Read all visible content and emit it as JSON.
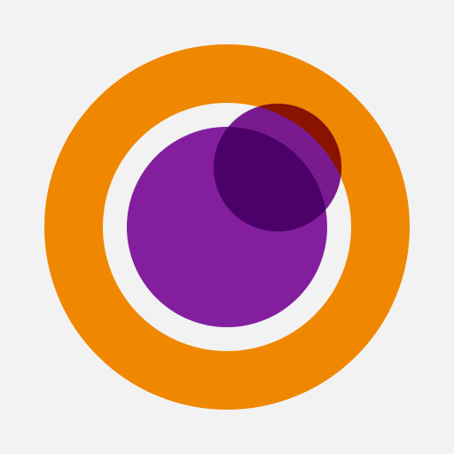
{
  "logo": {
    "name": "ring-and-circles-logo",
    "colors": {
      "background": "#f2f2f2",
      "ring": "#f08700",
      "large_circle": "#831f9f",
      "small_circle_overlap_circle": "#4b006a",
      "small_circle_overlap_ring_gap": "#8a1300",
      "small_circle_edge": "#7a1a8f"
    }
  }
}
